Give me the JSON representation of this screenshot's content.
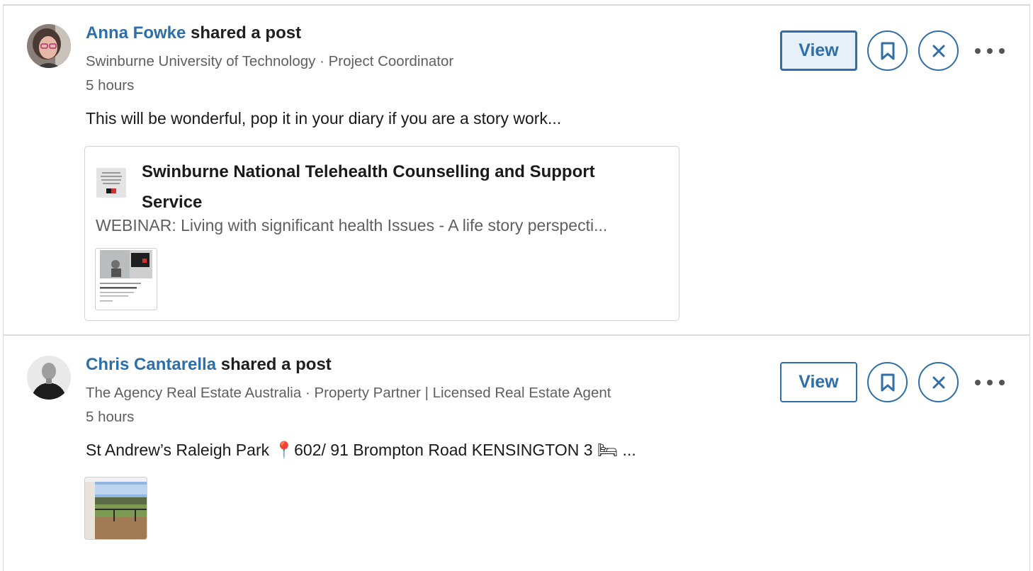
{
  "feed": [
    {
      "actor_name": "Anna Fowke",
      "action": " shared a post",
      "subtitle": "Swinburne University of Technology · Project Coordinator",
      "time": "5 hours",
      "text": "This will be wonderful, pop it in your diary if you are a story work...",
      "view_label": "View",
      "card": {
        "title": "Swinburne National Telehealth Counselling and Support Service",
        "subtitle": "WEBINAR: Living with significant health Issues - A life story perspecti..."
      }
    },
    {
      "actor_name": "Chris Cantarella",
      "action": " shared a post",
      "subtitle": "The Agency Real Estate Australia · Property Partner | Licensed Real Estate Agent",
      "time": "5 hours",
      "text": "St Andrew’s Raleigh Park 📍602/ 91 Brompton Road KENSINGTON 3 🛏 ...",
      "view_label": "View"
    }
  ],
  "colors": {
    "accent": "#2f6ea6",
    "actor_link": "#2d6fa8",
    "secondary_text": "#5f5f5f",
    "divider": "#dcdcdc"
  },
  "icons": [
    "bookmark-icon",
    "close-icon",
    "more-icon"
  ]
}
